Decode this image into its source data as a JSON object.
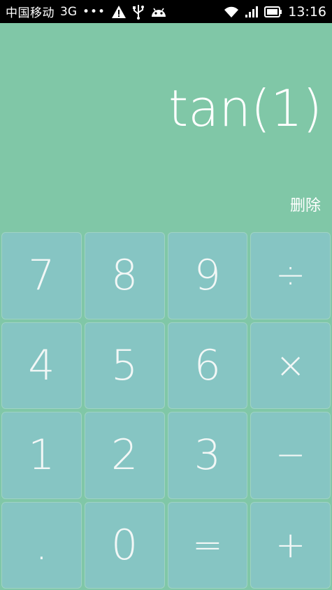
{
  "status_bar": {
    "carrier": "中国移动",
    "network": "3G",
    "dots": "•••",
    "time": "13:16",
    "icons": [
      "warning-icon",
      "usb-icon",
      "android-icon",
      "wifi-icon",
      "signal-icon",
      "battery-icon"
    ]
  },
  "display": {
    "expression": "tan(1)",
    "delete_label": "删除"
  },
  "keys": [
    {
      "label": "7"
    },
    {
      "label": "8"
    },
    {
      "label": "9"
    },
    {
      "label": "÷"
    },
    {
      "label": "4"
    },
    {
      "label": "5"
    },
    {
      "label": "6"
    },
    {
      "label": "×"
    },
    {
      "label": "1"
    },
    {
      "label": "2"
    },
    {
      "label": "3"
    },
    {
      "label": "−"
    },
    {
      "label": "."
    },
    {
      "label": "0"
    },
    {
      "label": "="
    },
    {
      "label": "+"
    }
  ],
  "colors": {
    "background": "#80c7a7",
    "key": "#86c5c3",
    "text": "#ffffff"
  }
}
